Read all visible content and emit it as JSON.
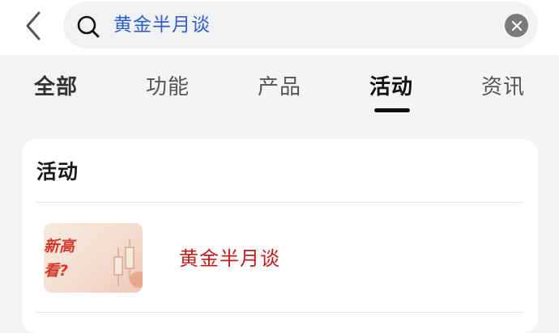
{
  "search": {
    "query": "黄金半月谈"
  },
  "tabs": [
    {
      "label": "全部"
    },
    {
      "label": "功能"
    },
    {
      "label": "产品"
    },
    {
      "label": "活动"
    },
    {
      "label": "资讯"
    }
  ],
  "active_tab": "活动",
  "section": {
    "title": "活动",
    "items": [
      {
        "thumbnail_text_line1": "新高",
        "thumbnail_text_line2": "看?",
        "title": "黄金半月谈"
      }
    ]
  },
  "colors": {
    "search_text": "#2f5fcb",
    "item_title": "#c41b1b",
    "page_background": "#f3f4f6"
  },
  "icons": {
    "back": "chevron-left-icon",
    "search": "search-icon",
    "clear": "clear-circle-icon"
  }
}
